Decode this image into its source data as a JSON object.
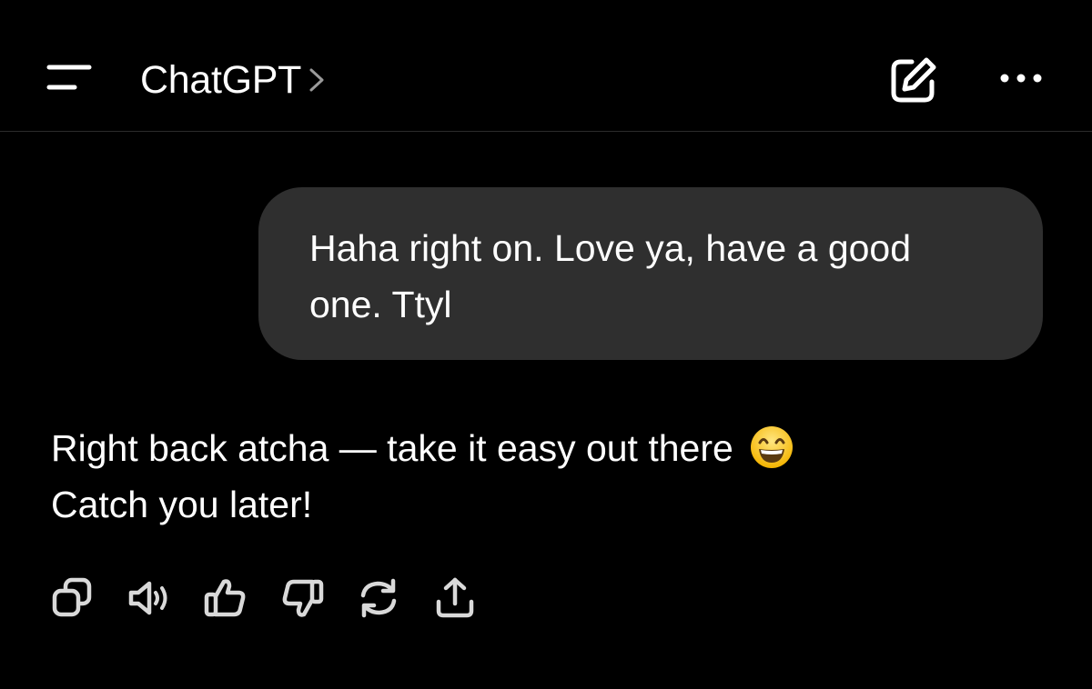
{
  "header": {
    "title": "ChatGPT",
    "icons": {
      "menu": "menu-icon",
      "title_chevron": "chevron-right-icon",
      "new_chat": "edit-icon",
      "more": "more-horizontal-icon"
    }
  },
  "conversation": {
    "user_message": {
      "lines": [
        "Haha right on. Love ya, have a good",
        "one. Ttyl"
      ]
    },
    "assistant_message": {
      "lines": [
        "Right back atcha — take it easy out there",
        "Catch you later!"
      ],
      "emoji": "grinning-face-with-smiling-eyes-emoji"
    },
    "action_icons": [
      "copy-icon",
      "read-aloud-icon",
      "thumbs-up-icon",
      "thumbs-down-icon",
      "regenerate-icon",
      "share-icon"
    ]
  },
  "colors": {
    "background": "#000000",
    "text": "#ffffff",
    "user_bubble": "#2f2f2f",
    "icon": "#d9d9d9",
    "divider": "#2b2b2b"
  }
}
